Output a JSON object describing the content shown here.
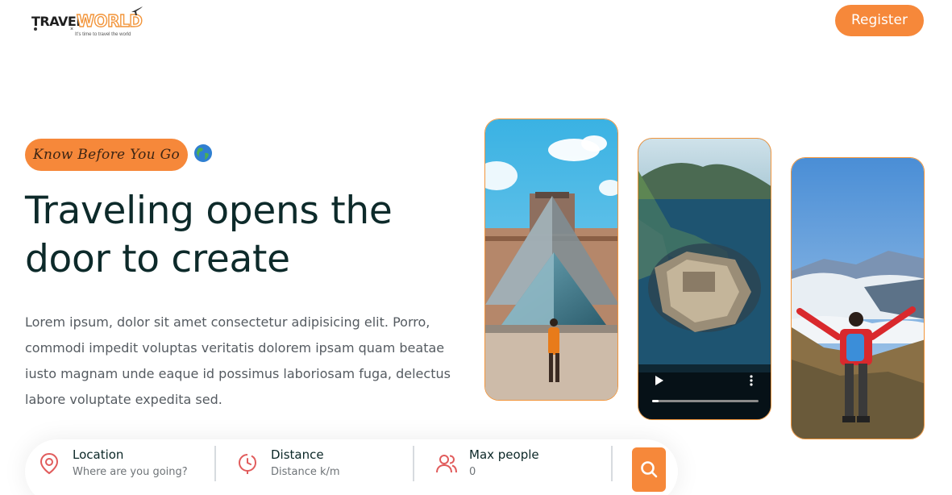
{
  "header": {
    "logo_part1": "TRAVEL",
    "logo_part2": "WORLD",
    "logo_tagline": "It's time to travel the world",
    "register_label": "Register"
  },
  "hero": {
    "subtitle": "Know Before You Go",
    "title_line1": "Traveling opens the",
    "title_line2": "door to create",
    "description": "Lorem ipsum, dolor sit amet consectetur adipisicing elit. Porro, commodi impedit voluptas veritatis dolorem ipsam quam beatae iusto magnam unde eaque id possimus laboriosam fuga, delectus labore voluptate expedita sed."
  },
  "search": {
    "location_label": "Location",
    "location_placeholder": "Where are you going?",
    "distance_label": "Distance",
    "distance_placeholder": "Distance k/m",
    "people_label": "Max people",
    "people_placeholder": "0"
  },
  "colors": {
    "accent": "#f6883a",
    "heading": "#0d2a2a",
    "icon": "#e15c5c"
  },
  "icons": [
    "airplane-icon",
    "globe-icon",
    "location-pin-icon",
    "clock-icon",
    "group-icon",
    "search-icon",
    "play-icon",
    "more-vertical-icon"
  ]
}
